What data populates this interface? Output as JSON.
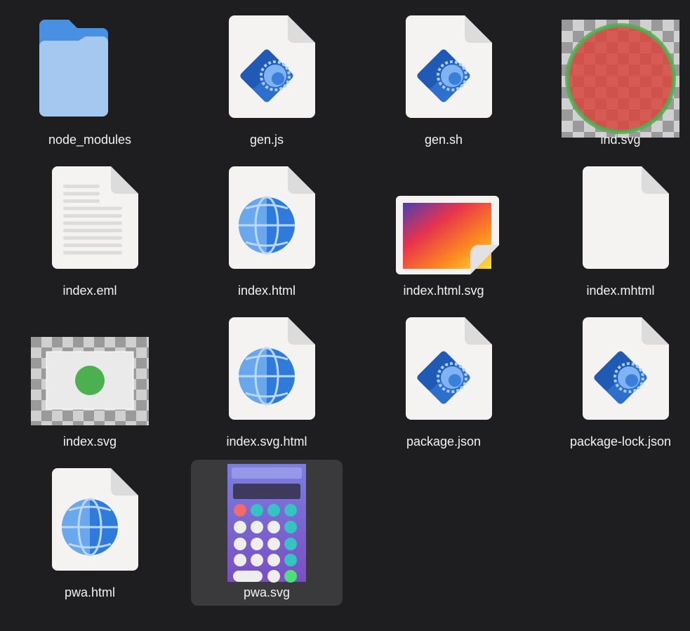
{
  "files": [
    {
      "name": "node_modules",
      "icon": "folder-icon"
    },
    {
      "name": "gen.js",
      "icon": "script-file-icon"
    },
    {
      "name": "gen.sh",
      "icon": "script-file-icon"
    },
    {
      "name": "ind.svg",
      "icon": "svg-thumbnail-red-circle"
    },
    {
      "name": "index.eml",
      "icon": "text-document-icon"
    },
    {
      "name": "index.html",
      "icon": "web-globe-file-icon"
    },
    {
      "name": "index.html.svg",
      "icon": "image-file-icon"
    },
    {
      "name": "index.mhtml",
      "icon": "blank-file-icon"
    },
    {
      "name": "index.svg",
      "icon": "svg-thumbnail-green-dot"
    },
    {
      "name": "index.svg.html",
      "icon": "web-globe-file-icon"
    },
    {
      "name": "package.json",
      "icon": "script-file-icon"
    },
    {
      "name": "package-lock.json",
      "icon": "script-file-icon"
    },
    {
      "name": "pwa.html",
      "icon": "web-globe-file-icon"
    },
    {
      "name": "pwa.svg",
      "icon": "svg-thumbnail-calculator",
      "selected": true
    }
  ],
  "colors": {
    "background": "#1e1e20",
    "selection": "#3a3a3d",
    "folder": "#a4c8f0",
    "folder_tab": "#4a90e2",
    "page": "#f4f3f2",
    "page_fold": "#dcdcdc",
    "accent_blue": "#3a7fd9"
  }
}
